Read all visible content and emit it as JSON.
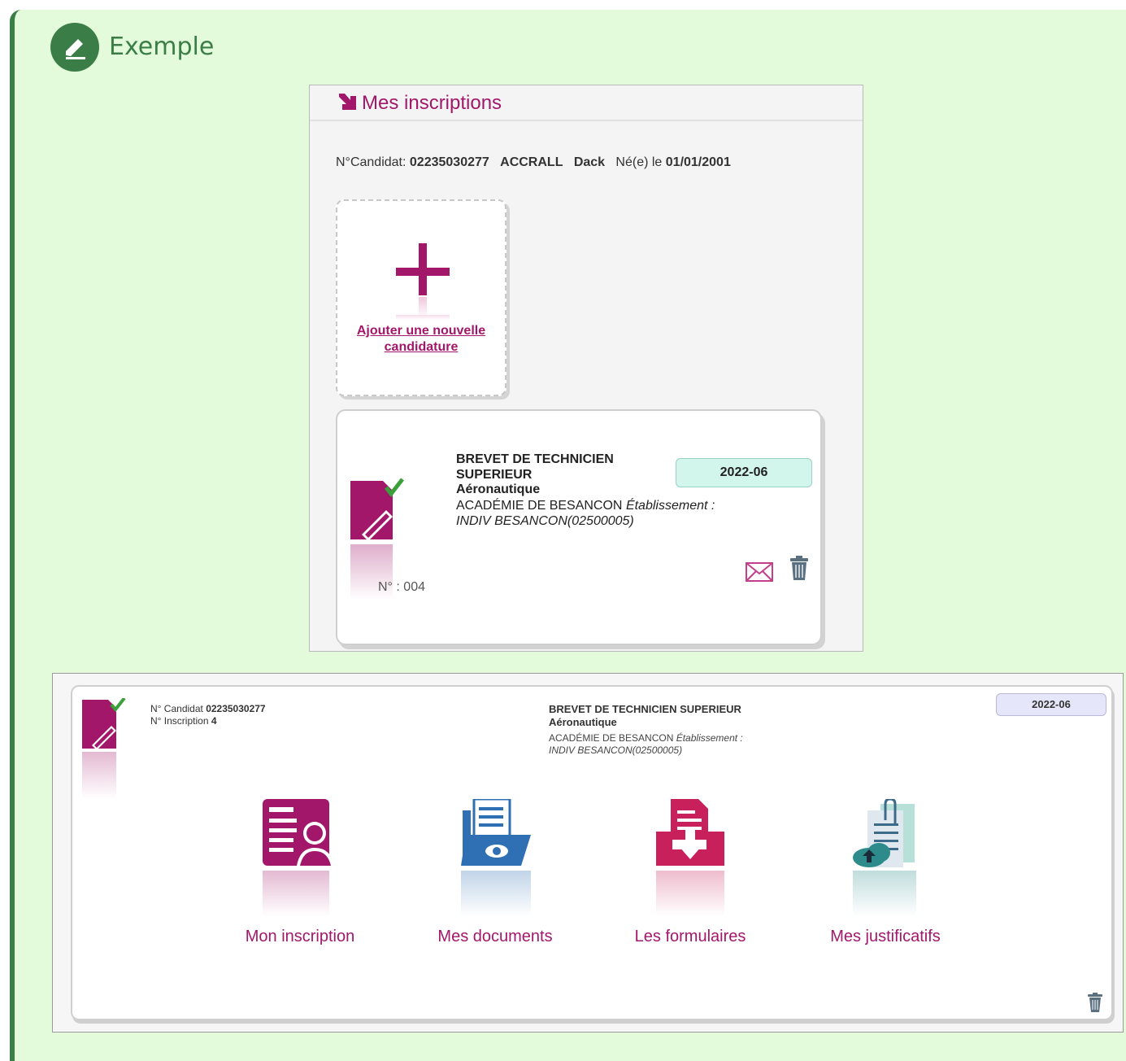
{
  "callout": {
    "title": "Exemple",
    "icon": "edit-icon"
  },
  "inscriptions": {
    "title": "Mes inscriptions",
    "candidate": {
      "label": "N°Candidat:",
      "number": "02235030277",
      "last_name": "ACCRALL",
      "first_name": "Dack",
      "born_label": "Né(e) le",
      "birth_date": "01/01/2001"
    },
    "add_card": {
      "label_line1": "Ajouter une nouvelle",
      "label_line2": "candidature"
    },
    "application": {
      "title_line1": "BREVET DE TECHNICIEN",
      "title_line2": "SUPERIEUR",
      "specialty": "Aéronautique",
      "academy": "ACADÉMIE DE BESANCON",
      "etab_label": "Établissement :",
      "etab_value": "INDIV BESANCON(02500005)",
      "session": "2022-06",
      "number": "N° : 004"
    }
  },
  "detail": {
    "candidate_label": "N° Candidat",
    "candidate_number": "02235030277",
    "inscription_label": "N° Inscription",
    "inscription_number": "4",
    "title": "BREVET DE TECHNICIEN SUPERIEUR",
    "specialty": "Aéronautique",
    "academy": "ACADÉMIE DE BESANCON",
    "etab_label": "Établissement :",
    "etab_value": "INDIV BESANCON(02500005)",
    "session": "2022-06",
    "tiles": [
      {
        "label": "Mon inscription",
        "icon": "user-form-icon"
      },
      {
        "label": "Mes documents",
        "icon": "folder-eye-icon"
      },
      {
        "label": "Les formulaires",
        "icon": "form-download-icon"
      },
      {
        "label": "Mes justificatifs",
        "icon": "clip-upload-icon"
      }
    ]
  },
  "colors": {
    "accent": "#a3176a",
    "callout_bg": "#e4fbdb",
    "callout_border": "#3b7d47"
  }
}
